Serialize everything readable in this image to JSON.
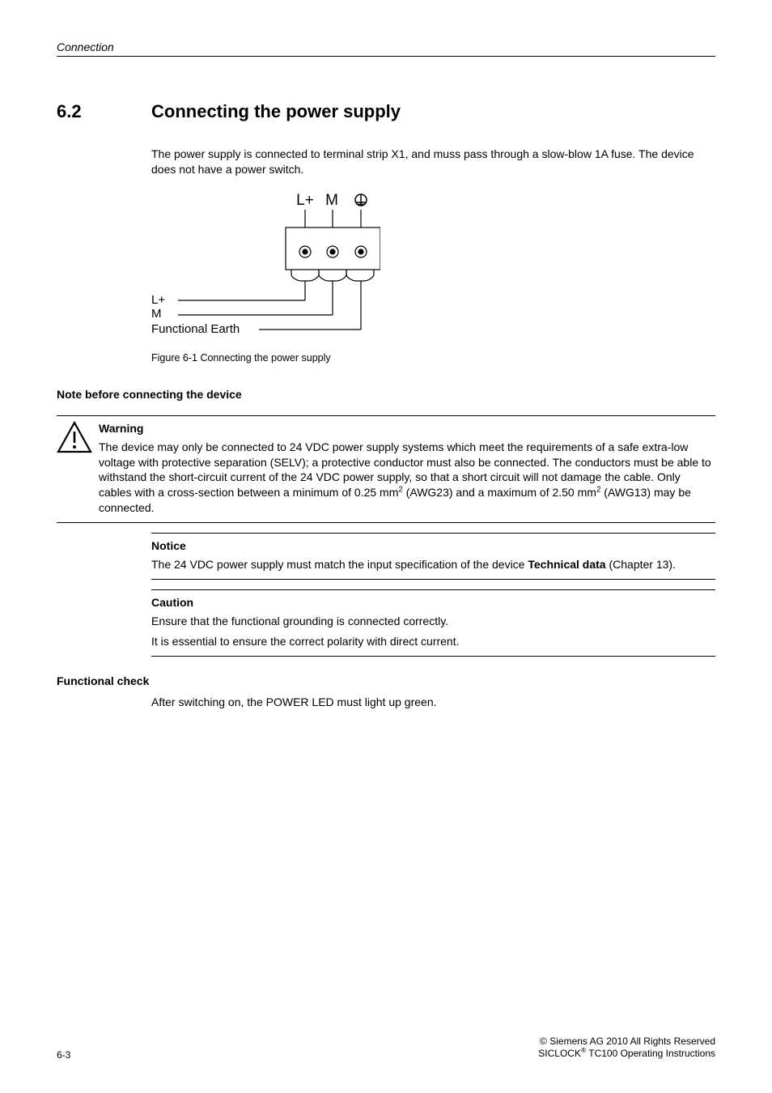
{
  "header": {
    "running_title": "Connection"
  },
  "section": {
    "number": "6.2",
    "title": "Connecting the power supply",
    "intro": "The power supply is connected to terminal strip X1, and muss pass through a slow-blow 1A fuse. The device does not have a power switch."
  },
  "figure": {
    "top_labels": {
      "l_plus": "L+",
      "m": "M"
    },
    "left_labels": {
      "l_plus": "L+",
      "m": "M",
      "earth": "Functional Earth"
    },
    "caption": "Figure 6-1 Connecting the power supply"
  },
  "note_head": "Note before connecting the device",
  "warning": {
    "head": "Warning",
    "body_before_sup1": "The device may only be connected to 24 VDC power supply systems which meet the requirements of a safe extra-low voltage with protective separation (SELV); a protective conductor must also be connected. The conductors must be able to withstand the short-circuit current of the 24 VDC power supply, so that a short circuit will not damage the cable. Only cables with a cross-section between a minimum of  0.25 mm",
    "sup1": "2",
    "body_mid": " (AWG23) and a maximum of 2.50 mm",
    "sup2": "2",
    "body_after": " (AWG13) may be connected."
  },
  "notice": {
    "head": "Notice",
    "line1": "The 24 VDC power supply must match the input specification of the device ",
    "bold": "Technical data",
    "line1_tail": " (Chapter 13)."
  },
  "caution": {
    "head": "Caution",
    "line1": "Ensure that the functional grounding is connected correctly.",
    "line2": "It is essential to ensure the correct polarity with direct current."
  },
  "functional": {
    "head": "Functional check",
    "body": "After switching on, the POWER LED must light up green."
  },
  "footer": {
    "page": "6-3",
    "copyright": "© Siemens AG 2010 All Rights Reserved",
    "doc_before": "SICLOCK",
    "doc_sup": "®",
    "doc_after": " TC100 Operating Instructions"
  }
}
